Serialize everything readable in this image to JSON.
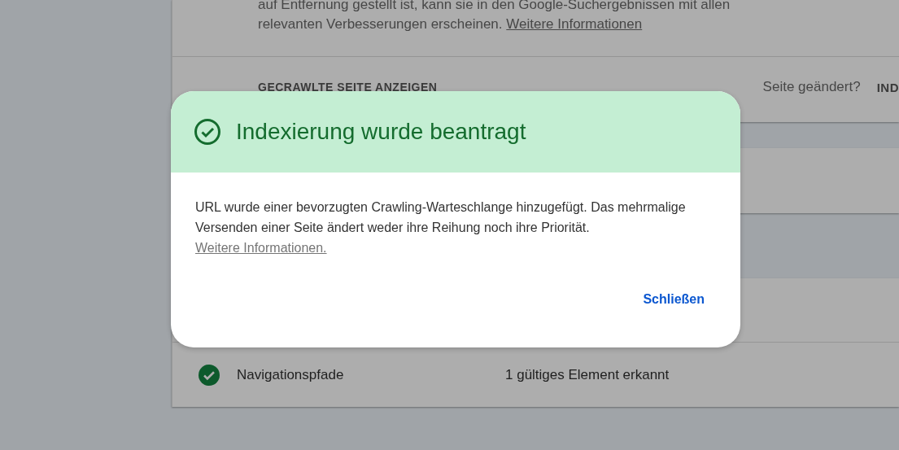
{
  "background": {
    "intro": {
      "lines": [
        "auf Entfernung gestellt ist, kann sie in den Google-Suchergebnissen mit allen",
        "relevanten Verbesserungen erscheinen."
      ],
      "link": "Weitere Informationen"
    },
    "crawled_page_link": "GECRAWLTE SEITE ANZEIGEN",
    "page_changed": "Seite geändert?",
    "request_indexing": "IND",
    "enhancements": [
      {
        "name": "Navigationspfade",
        "status": "1 gültiges Element erkannt",
        "valid": true
      }
    ]
  },
  "dialog": {
    "title": "Indexierung wurde beantragt",
    "message": "URL wurde einer bevorzugten Crawling-Warteschlange hinzugefügt. Das mehrmalige Versenden einer Seite ändert weder ihre Reihung noch ihre Priorität.",
    "link": "Weitere Informationen.",
    "close_button": "Schließen"
  }
}
